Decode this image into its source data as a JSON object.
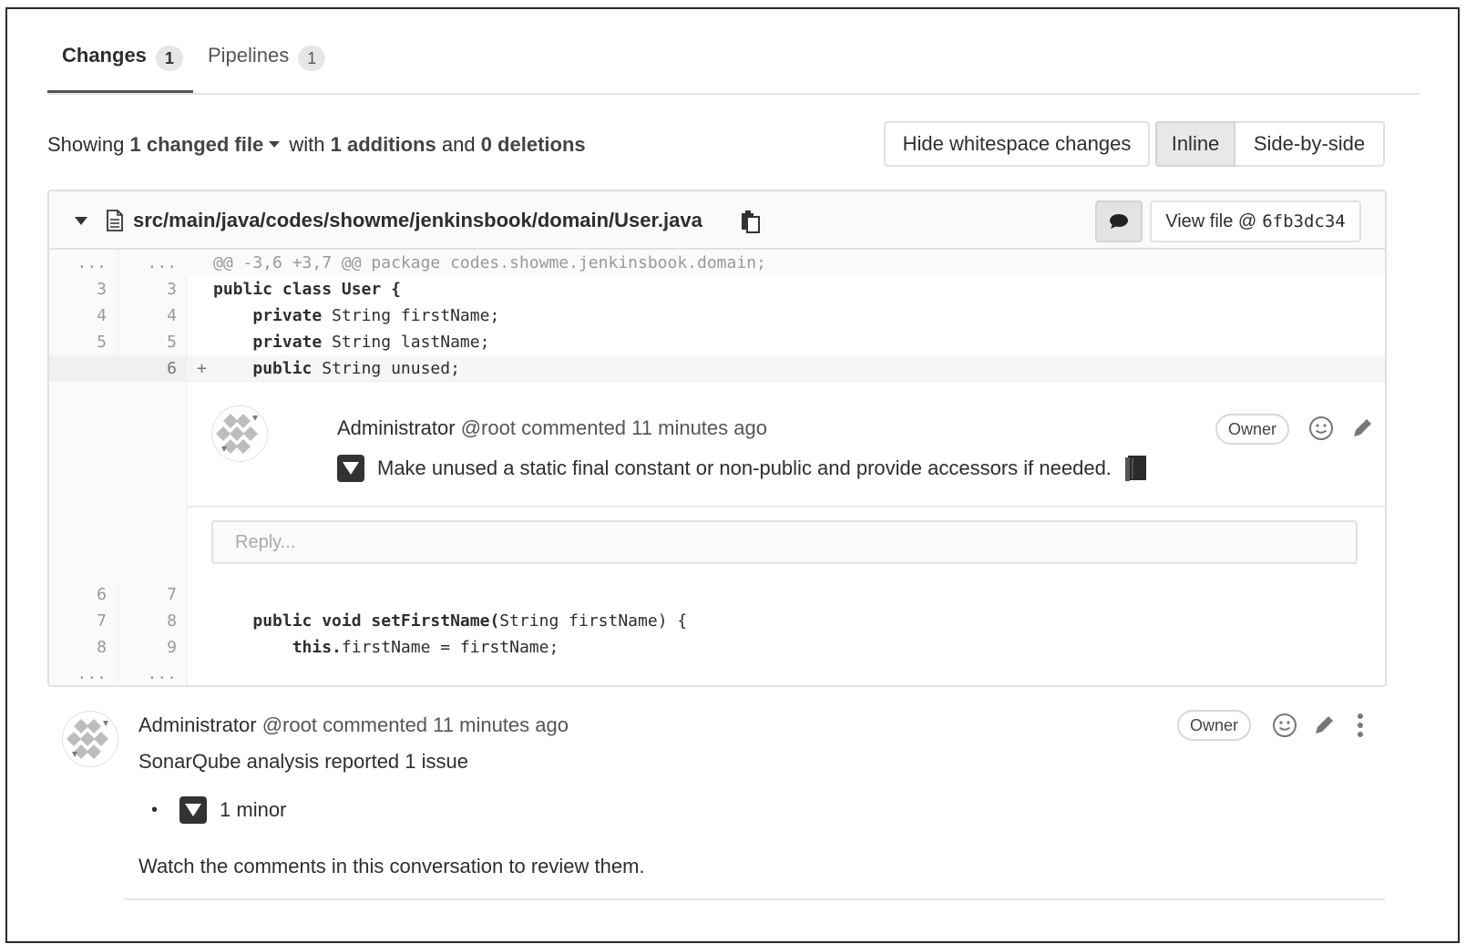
{
  "tabs": [
    {
      "label": "Changes",
      "count": "1"
    },
    {
      "label": "Pipelines",
      "count": "1"
    }
  ],
  "summary": {
    "showing": "Showing",
    "files": "1 changed file",
    "with": "with",
    "additions": "1 additions",
    "and": "and",
    "deletions": "0 deletions"
  },
  "toolbar": {
    "whitespace_label": "Hide whitespace changes",
    "inline_label": "Inline",
    "sidebyside_label": "Side-by-side"
  },
  "file": {
    "path": "src/main/java/codes/showme/jenkinsbook/domain/User.java",
    "view_file_label": "View file @",
    "commit_sha": "6fb3dc34"
  },
  "diff": {
    "ellipsis": "...",
    "hunk_header": "@@ -3,6 +3,7 @@ package codes.showme.jenkinsbook.domain;",
    "lines": [
      {
        "old": "3",
        "new": "3",
        "kw": "public class",
        "rest": " User {",
        "indent": ""
      },
      {
        "old": "4",
        "new": "4",
        "kw": "private",
        "rest": " String firstName;",
        "indent": "    "
      },
      {
        "old": "5",
        "new": "5",
        "kw": "private",
        "rest": " String lastName;",
        "indent": "    "
      }
    ],
    "added_line": {
      "old": "",
      "new": "6",
      "marker": "+",
      "kw": "public",
      "rest": " String unused;",
      "indent": "    "
    },
    "after_lines": [
      {
        "old": "6",
        "new": "7",
        "kw": "",
        "rest": "",
        "indent": ""
      },
      {
        "old": "7",
        "new": "8",
        "kw": "public void setFirstName(",
        "rest": "String firstName) {",
        "indent": "    "
      },
      {
        "old": "8",
        "new": "9",
        "kw": "this.",
        "rest": "firstName = firstName;",
        "indent": "        "
      }
    ]
  },
  "inline_comment": {
    "author": "Administrator",
    "handle": "@root",
    "action": "commented",
    "time": "11 minutes ago",
    "role": "Owner",
    "body": "Make unused a static final constant or non-public and provide accessors if needed.",
    "reply_placeholder": "Reply..."
  },
  "main_comment": {
    "author": "Administrator",
    "handle": "@root",
    "action": "commented",
    "time": "11 minutes ago",
    "role": "Owner",
    "intro": "SonarQube analysis reported 1 issue",
    "issue": "1 minor",
    "footer": "Watch the comments in this conversation to review them."
  }
}
